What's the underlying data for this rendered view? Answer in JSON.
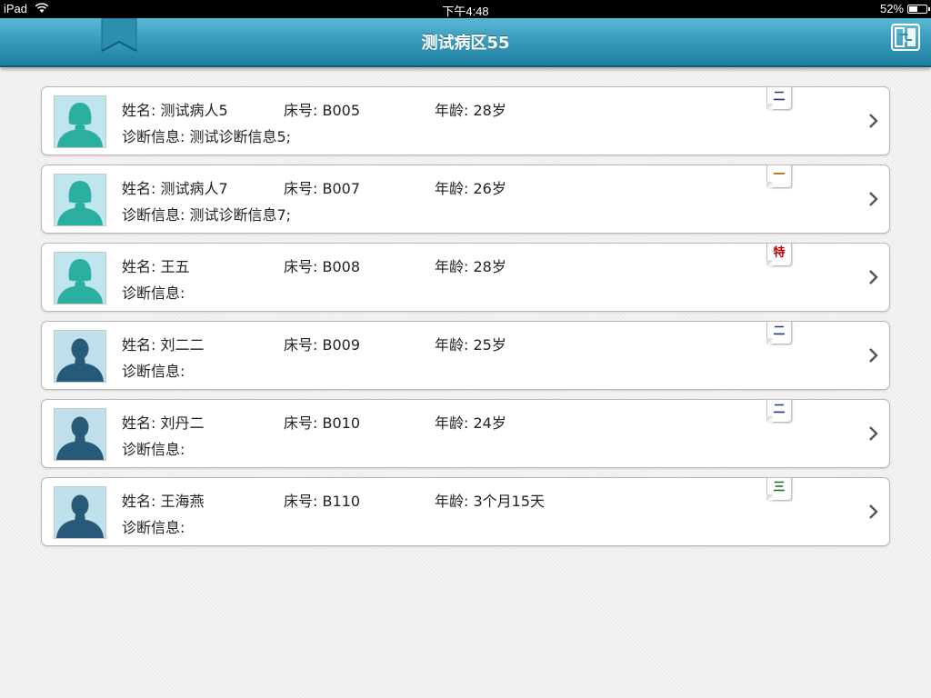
{
  "status_bar": {
    "device": "iPad",
    "time": "下午4:48",
    "battery": "52%",
    "battery_level": 0.52
  },
  "nav": {
    "title": "测试病区55",
    "bookmark_icon": "bookmark-icon",
    "switch_icon": "switch-account-icon"
  },
  "labels": {
    "name": "姓名:",
    "bed": "床号:",
    "age": "年龄:",
    "diagnosis": "诊断信息:"
  },
  "colors": {
    "female_avatar": "#2aafa0",
    "male_avatar": "#275a78",
    "nav_top": "#5bb8d3",
    "nav_bottom": "#1d7fa0"
  },
  "patients": [
    {
      "name": "测试病人5",
      "bed": "B005",
      "age": "28岁",
      "diagnosis": "测试诊断信息5;",
      "level": "二",
      "level_color": "#1f3d7a",
      "avatar": "female"
    },
    {
      "name": "测试病人7",
      "bed": "B007",
      "age": "26岁",
      "diagnosis": "测试诊断信息7;",
      "level": "一",
      "level_color": "#b05a00",
      "avatar": "female"
    },
    {
      "name": "王五",
      "bed": "B008",
      "age": "28岁",
      "diagnosis": "",
      "level": "特",
      "level_color": "#c00000",
      "avatar": "female"
    },
    {
      "name": "刘二二",
      "bed": "B009",
      "age": "25岁",
      "diagnosis": "",
      "level": "二",
      "level_color": "#1f3d7a",
      "avatar": "male"
    },
    {
      "name": "刘丹二",
      "bed": "B010",
      "age": "24岁",
      "diagnosis": "",
      "level": "二",
      "level_color": "#1f3d7a",
      "avatar": "male"
    },
    {
      "name": "王海燕",
      "bed": "B110",
      "age": "3个月15天",
      "diagnosis": "",
      "level": "三",
      "level_color": "#1d6b1d",
      "avatar": "male"
    }
  ]
}
